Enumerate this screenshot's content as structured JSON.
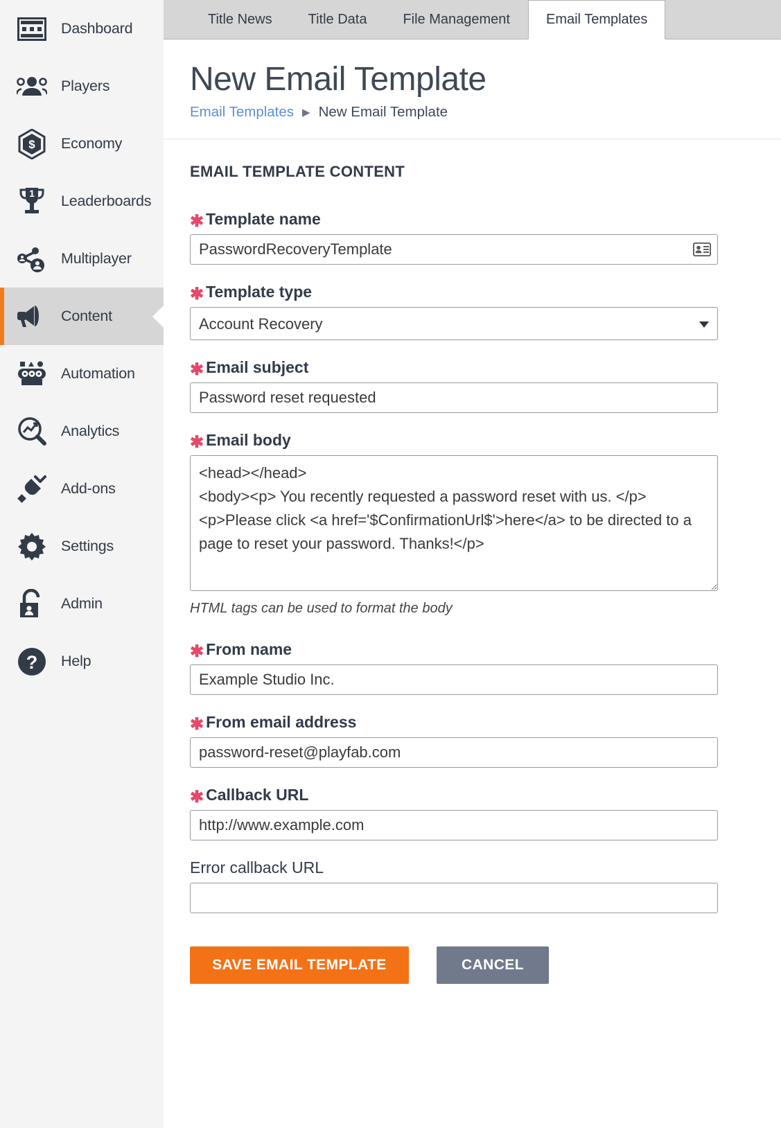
{
  "sidebar": {
    "items": [
      {
        "label": "Dashboard",
        "icon": "dashboard-icon",
        "active": false
      },
      {
        "label": "Players",
        "icon": "players-icon",
        "active": false
      },
      {
        "label": "Economy",
        "icon": "economy-icon",
        "active": false
      },
      {
        "label": "Leaderboards",
        "icon": "leaderboards-icon",
        "active": false
      },
      {
        "label": "Multiplayer",
        "icon": "multiplayer-icon",
        "active": false
      },
      {
        "label": "Content",
        "icon": "content-icon",
        "active": true
      },
      {
        "label": "Automation",
        "icon": "automation-icon",
        "active": false
      },
      {
        "label": "Analytics",
        "icon": "analytics-icon",
        "active": false
      },
      {
        "label": "Add-ons",
        "icon": "addons-icon",
        "active": false
      },
      {
        "label": "Settings",
        "icon": "settings-icon",
        "active": false
      },
      {
        "label": "Admin",
        "icon": "admin-icon",
        "active": false
      },
      {
        "label": "Help",
        "icon": "help-icon",
        "active": false
      }
    ],
    "accent_color": "#f07c1e",
    "active_bg": "#d6d6d6",
    "bg": "#f4f4f4"
  },
  "tabs": [
    {
      "label": "Title News",
      "active": false
    },
    {
      "label": "Title Data",
      "active": false
    },
    {
      "label": "File Management",
      "active": false
    },
    {
      "label": "Email Templates",
      "active": true
    }
  ],
  "header": {
    "title": "New Email Template",
    "breadcrumb": {
      "link": "Email Templates",
      "separator": "▶",
      "current": "New Email Template"
    }
  },
  "form": {
    "section_title": "EMAIL TEMPLATE CONTENT",
    "required_marker": "✱",
    "required_color": "#e4486a",
    "fields": {
      "template_name": {
        "label": "Template name",
        "required": true,
        "value": "PasswordRecoveryTemplate",
        "placeholder": "",
        "icon": "contact-card-icon"
      },
      "template_type": {
        "label": "Template type",
        "required": true,
        "value": "Account Recovery",
        "options": [
          "Account Recovery"
        ]
      },
      "email_subject": {
        "label": "Email subject",
        "required": true,
        "value": "Password reset requested",
        "placeholder": ""
      },
      "email_body": {
        "label": "Email body",
        "required": true,
        "value": "<head></head>\n<body><p> You recently requested a password reset with us. </p>\n<p>Please click <a href='$ConfirmationUrl$'>here</a> to be directed to a page to reset your password. Thanks!</p>",
        "placeholder": "",
        "help": "HTML tags can be used to format the body"
      },
      "from_name": {
        "label": "From name",
        "required": true,
        "value": "Example Studio Inc.",
        "placeholder": ""
      },
      "from_email": {
        "label": "From email address",
        "required": true,
        "value": "password-reset@playfab.com",
        "placeholder": ""
      },
      "callback_url": {
        "label": "Callback URL",
        "required": true,
        "value": "http://www.example.com",
        "placeholder": ""
      },
      "error_callback_url": {
        "label": "Error callback URL",
        "required": false,
        "value": "",
        "placeholder": ""
      }
    },
    "buttons": {
      "save": {
        "label": "SAVE EMAIL TEMPLATE",
        "color": "#f47216"
      },
      "cancel": {
        "label": "CANCEL",
        "color": "#707a8c"
      }
    }
  }
}
